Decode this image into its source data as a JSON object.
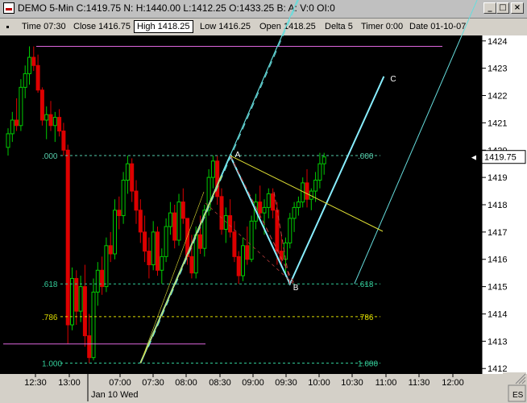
{
  "window": {
    "title": "DEMO 5-Min C:1419.75 N: H:1440.00 L:1412.25 O:1433.25 B: A: V:0 OI:0"
  },
  "infobar": {
    "time": "Time 07:30",
    "close": "Close 1416.75",
    "high": "High 1418.25",
    "low": "Low 1416.25",
    "open": "Open 1418.25",
    "delta": "Delta 5",
    "timer": "Timer 0:00",
    "date": "Date 01-10-07"
  },
  "colors": {
    "background": "#000000",
    "up_candle": "#00cc00",
    "down_candle": "#dd0000",
    "fib_line": "#33cc99",
    "fib_786": "#dddd00",
    "horizontal_line": "#dd66dd",
    "channel_line": "#66dddd",
    "trend_line": "#dddd33",
    "pitchfork": "#cc4444",
    "price_box": "#ffffff"
  },
  "chart_data": {
    "type": "candlestick",
    "instrument": "ES",
    "interval": "5-Min",
    "date_label": "Jan 10 Wed",
    "x_ticks": [
      "12:30",
      "13:00",
      "07:00",
      "07:30",
      "08:00",
      "08:30",
      "09:00",
      "09:30",
      "10:00",
      "10:30",
      "11:00",
      "11:30",
      "12:00"
    ],
    "y_ticks": [
      1412,
      1413,
      1414,
      1415,
      1416,
      1417,
      1418,
      1419,
      1420,
      1421,
      1422,
      1423,
      1424
    ],
    "ylim": [
      1411.8,
      1424.2
    ],
    "last_price": 1419.75,
    "last_price_label": "1419.75",
    "fib_levels": [
      {
        "ratio": 0,
        "left_label": ".000",
        "right_label": ".000",
        "price": 1419.8
      },
      {
        "ratio": 0.618,
        "left_label": ".618",
        "right_label": ".618",
        "price": 1415.1
      },
      {
        "ratio": 0.786,
        "left_label": ".786",
        "right_label": ".786",
        "price": 1413.9
      },
      {
        "ratio": 1,
        "left_label": "1.000",
        "right_label": "1.000",
        "price": 1412.2
      }
    ],
    "horizontal_lines": [
      1423.8,
      1412.9
    ],
    "points": [
      {
        "label": "",
        "bar": 31,
        "price": 1412.2
      },
      {
        "label": "A",
        "bar": 52,
        "price": 1419.8
      },
      {
        "label": "B",
        "bar": 66,
        "price": 1415.1
      },
      {
        "label": "C",
        "bar": 88,
        "price": 1422.7
      }
    ],
    "candles": [
      [
        1420.1,
        1420.8,
        1419.8,
        1420.6
      ],
      [
        1420.6,
        1421.4,
        1420.3,
        1421.1
      ],
      [
        1421.1,
        1421.9,
        1420.7,
        1420.9
      ],
      [
        1420.9,
        1422.6,
        1420.7,
        1422.3
      ],
      [
        1422.3,
        1423.1,
        1421.9,
        1422.8
      ],
      [
        1422.8,
        1423.8,
        1422.4,
        1423.4
      ],
      [
        1423.4,
        1423.8,
        1422.9,
        1423.1
      ],
      [
        1423.1,
        1423.5,
        1422.1,
        1422.2
      ],
      [
        1422.2,
        1422.3,
        1420.9,
        1421.1
      ],
      [
        1421.1,
        1421.6,
        1420.4,
        1421.3
      ],
      [
        1421.3,
        1421.8,
        1420.7,
        1420.9
      ],
      [
        1420.9,
        1421.4,
        1420.3,
        1421.2
      ],
      [
        1421.2,
        1421.5,
        1420.5,
        1420.7
      ],
      [
        1420.7,
        1421.0,
        1419.8,
        1420.0
      ],
      [
        1420.0,
        1420.2,
        1412.9,
        1413.6
      ],
      [
        1413.6,
        1415.7,
        1413.4,
        1415.3
      ],
      [
        1415.3,
        1415.6,
        1413.6,
        1414.1
      ],
      [
        1414.1,
        1415.4,
        1413.7,
        1415.0
      ],
      [
        1415.0,
        1415.8,
        1412.8,
        1413.2
      ],
      [
        1413.2,
        1414.0,
        1412.2,
        1412.4
      ],
      [
        1412.4,
        1415.3,
        1412.3,
        1414.8
      ],
      [
        1414.8,
        1415.9,
        1414.3,
        1415.6
      ],
      [
        1415.6,
        1416.1,
        1414.7,
        1415.0
      ],
      [
        1415.0,
        1416.8,
        1414.8,
        1416.5
      ],
      [
        1416.5,
        1417.0,
        1415.9,
        1416.2
      ],
      [
        1416.2,
        1418.2,
        1416.0,
        1417.8
      ],
      [
        1417.8,
        1418.3,
        1417.1,
        1417.6
      ],
      [
        1417.6,
        1419.2,
        1417.3,
        1418.9
      ],
      [
        1418.9,
        1419.8,
        1418.4,
        1419.5
      ],
      [
        1419.5,
        1419.7,
        1418.1,
        1418.5
      ],
      [
        1418.5,
        1418.9,
        1417.3,
        1417.8
      ],
      [
        1417.8,
        1418.2,
        1416.6,
        1417.0
      ],
      [
        1417.0,
        1417.6,
        1415.9,
        1416.3
      ],
      [
        1416.3,
        1416.8,
        1415.3,
        1415.8
      ],
      [
        1415.8,
        1417.4,
        1415.6,
        1417.0
      ],
      [
        1417.0,
        1417.2,
        1415.4,
        1415.6
      ],
      [
        1415.6,
        1416.4,
        1415.1,
        1416.1
      ],
      [
        1416.1,
        1417.5,
        1415.9,
        1417.2
      ],
      [
        1417.2,
        1418.1,
        1416.9,
        1417.7
      ],
      [
        1417.7,
        1418.0,
        1416.4,
        1416.7
      ],
      [
        1416.7,
        1418.4,
        1416.5,
        1418.1
      ],
      [
        1418.1,
        1418.6,
        1417.3,
        1417.5
      ],
      [
        1417.5,
        1416.3,
        1415.8,
        1416.1
      ],
      [
        1416.1,
        1416.9,
        1415.3,
        1415.5
      ],
      [
        1415.5,
        1417.2,
        1415.3,
        1416.9
      ],
      [
        1416.9,
        1417.6,
        1416.2,
        1416.4
      ],
      [
        1416.4,
        1418.0,
        1416.1,
        1417.8
      ],
      [
        1417.8,
        1419.3,
        1417.6,
        1419.0
      ],
      [
        1419.0,
        1419.8,
        1418.6,
        1419.6
      ],
      [
        1419.6,
        1419.8,
        1418.0,
        1418.3
      ],
      [
        1418.3,
        1418.6,
        1416.9,
        1417.1
      ],
      [
        1417.1,
        1417.9,
        1416.6,
        1417.6
      ],
      [
        1417.6,
        1418.2,
        1416.8,
        1417.0
      ],
      [
        1417.0,
        1417.4,
        1415.9,
        1416.1
      ],
      [
        1416.1,
        1416.3,
        1415.1,
        1415.4
      ],
      [
        1415.4,
        1416.8,
        1415.2,
        1416.5
      ],
      [
        1416.5,
        1417.2,
        1415.8,
        1416.0
      ],
      [
        1416.0,
        1417.6,
        1415.9,
        1417.4
      ],
      [
        1417.4,
        1418.4,
        1417.1,
        1418.1
      ],
      [
        1418.1,
        1418.7,
        1417.4,
        1417.7
      ],
      [
        1417.7,
        1418.2,
        1416.9,
        1417.9
      ],
      [
        1417.9,
        1418.6,
        1417.5,
        1418.4
      ],
      [
        1418.4,
        1418.6,
        1417.5,
        1417.8
      ],
      [
        1417.8,
        1418.1,
        1415.8,
        1416.3
      ],
      [
        1416.3,
        1416.9,
        1415.7,
        1416.0
      ],
      [
        1416.0,
        1416.8,
        1415.5,
        1416.6
      ],
      [
        1416.6,
        1417.7,
        1416.4,
        1417.5
      ],
      [
        1417.5,
        1418.1,
        1417.0,
        1417.9
      ],
      [
        1417.9,
        1418.3,
        1417.6,
        1418.1
      ],
      [
        1418.1,
        1419.0,
        1417.9,
        1418.8
      ],
      [
        1418.8,
        1419.3,
        1417.9,
        1418.2
      ],
      [
        1418.2,
        1418.6,
        1417.8,
        1418.5
      ],
      [
        1418.5,
        1419.2,
        1418.1,
        1418.9
      ],
      [
        1418.9,
        1419.9,
        1418.6,
        1419.5
      ],
      [
        1419.5,
        1419.9,
        1419.1,
        1419.75
      ]
    ]
  },
  "status": {
    "instrument_tab": "ES"
  }
}
